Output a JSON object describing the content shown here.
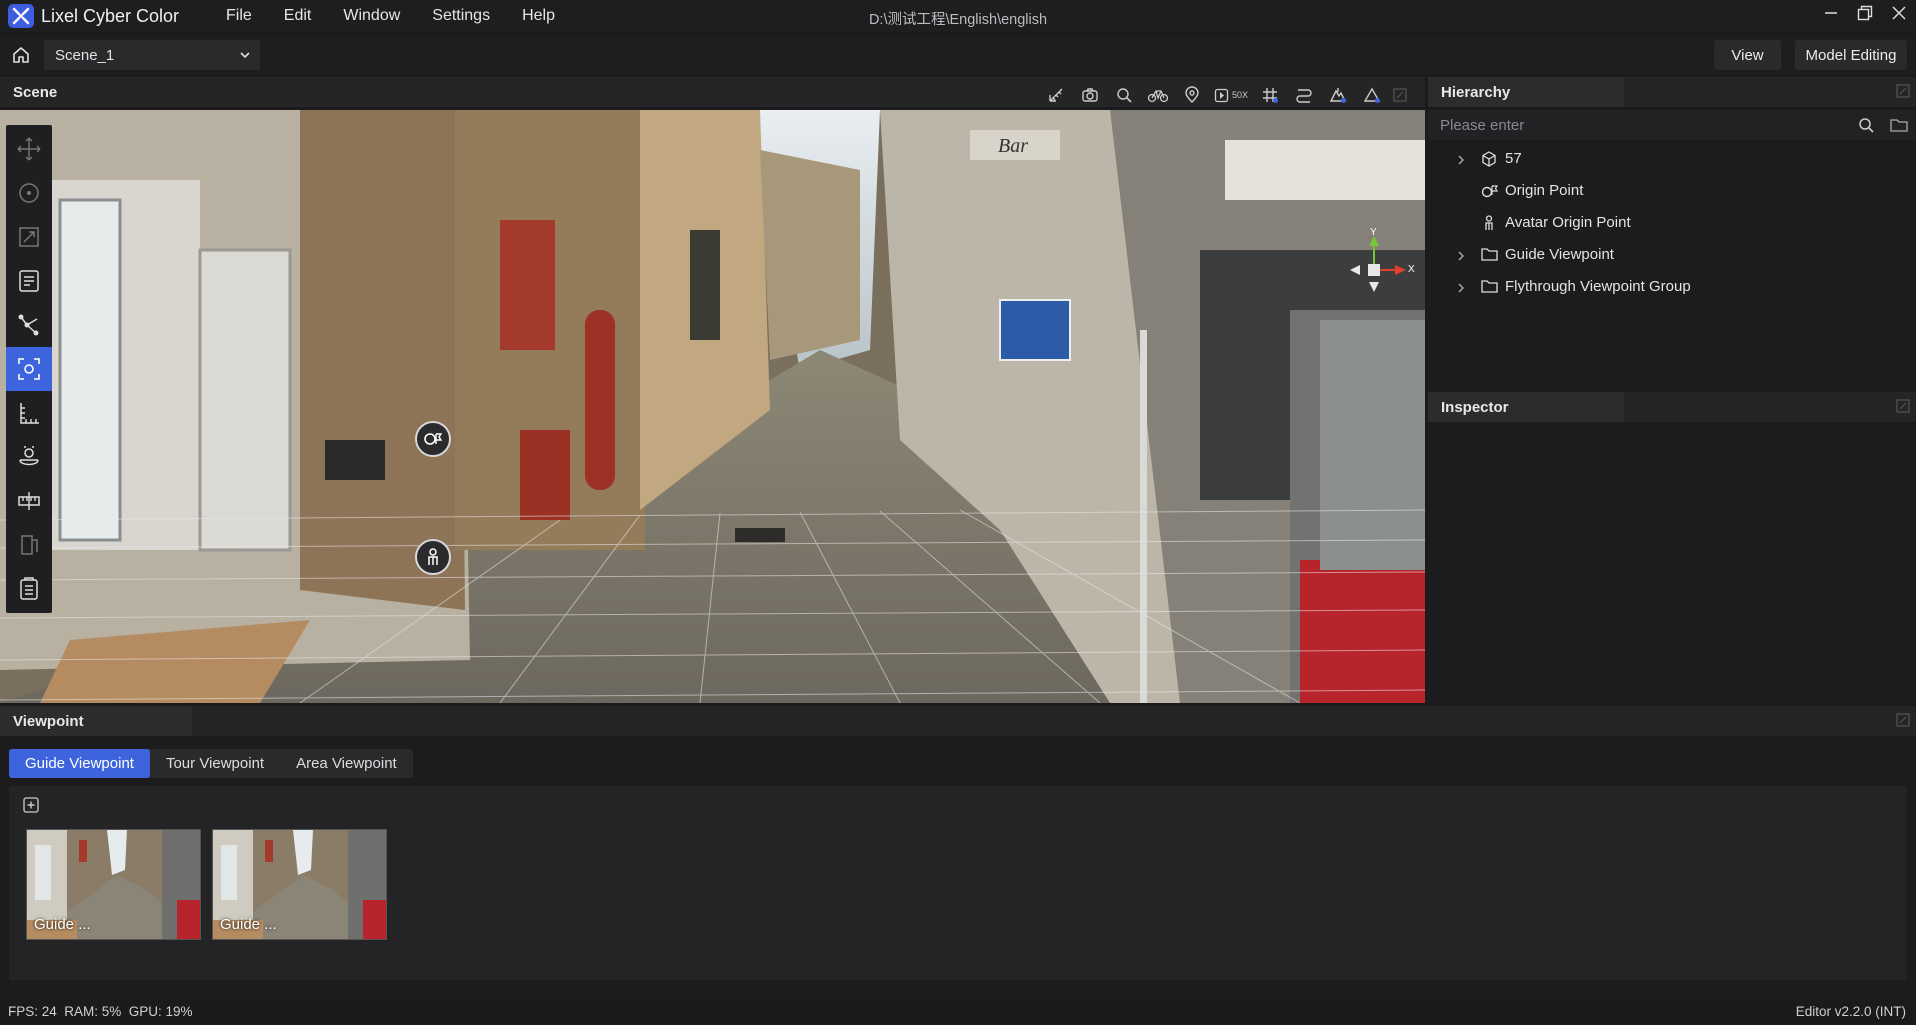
{
  "app": {
    "name": "Lixel Cyber Color",
    "window_path": "D:\\测试工程\\English\\english",
    "logo_icon": "lixel-logo-icon"
  },
  "menu": [
    {
      "label": "File"
    },
    {
      "label": "Edit"
    },
    {
      "label": "Window"
    },
    {
      "label": "Settings"
    },
    {
      "label": "Help"
    }
  ],
  "toolbar": {
    "scene_select_value": "Scene_1",
    "view_label": "View",
    "model_editing_label": "Model Editing"
  },
  "scene_panel": {
    "title": "Scene",
    "speed_label": "50X",
    "tools": [
      "ruler-icon",
      "camera-icon",
      "search-icon",
      "bicycle-icon",
      "location-pin-icon",
      "speed-icon",
      "grid-icon",
      "path-icon",
      "terrain-icon",
      "measure-icon",
      "maximize-icon"
    ]
  },
  "left_tools": [
    {
      "name": "move-icon",
      "active": false
    },
    {
      "name": "rotate-icon",
      "active": false
    },
    {
      "name": "scale-icon",
      "active": false
    },
    {
      "name": "annotation-icon",
      "active": false
    },
    {
      "name": "polyline-icon",
      "active": false
    },
    {
      "name": "focus-icon",
      "active": true
    },
    {
      "name": "measure-icon",
      "active": false
    },
    {
      "name": "avatar-icon",
      "active": false
    },
    {
      "name": "ruler-icon",
      "active": false
    },
    {
      "name": "section-icon",
      "active": false
    },
    {
      "name": "clipboard-icon",
      "active": false
    }
  ],
  "gizmo": {
    "y_label": "Y",
    "x_label": "X",
    "y_color": "#7ac53a",
    "x_color": "#e0402c"
  },
  "hierarchy": {
    "title": "Hierarchy",
    "search_placeholder": "Please enter",
    "items": [
      {
        "label": "57",
        "icon": "cube-icon",
        "expandable": true
      },
      {
        "label": "Origin Point",
        "icon": "origin-icon",
        "expandable": false
      },
      {
        "label": "Avatar Origin Point",
        "icon": "avatar-icon",
        "expandable": false
      },
      {
        "label": "Guide Viewpoint",
        "icon": "folder-icon",
        "expandable": true
      },
      {
        "label": "Flythrough Viewpoint Group",
        "icon": "folder-icon",
        "expandable": true
      }
    ]
  },
  "inspector": {
    "title": "Inspector"
  },
  "viewpoint": {
    "title": "Viewpoint",
    "tabs": [
      {
        "label": "Guide Viewpoint",
        "active": true
      },
      {
        "label": "Tour Viewpoint",
        "active": false
      },
      {
        "label": "Area Viewpoint",
        "active": false
      }
    ],
    "thumbnails": [
      {
        "label": "Guide ..."
      },
      {
        "label": "Guide ..."
      }
    ]
  },
  "status": {
    "metrics": "FPS: 24  RAM: 5%  GPU: 19%",
    "version": "Editor v2.2.0 (INT)"
  },
  "colors": {
    "accent": "#3e64dd"
  }
}
